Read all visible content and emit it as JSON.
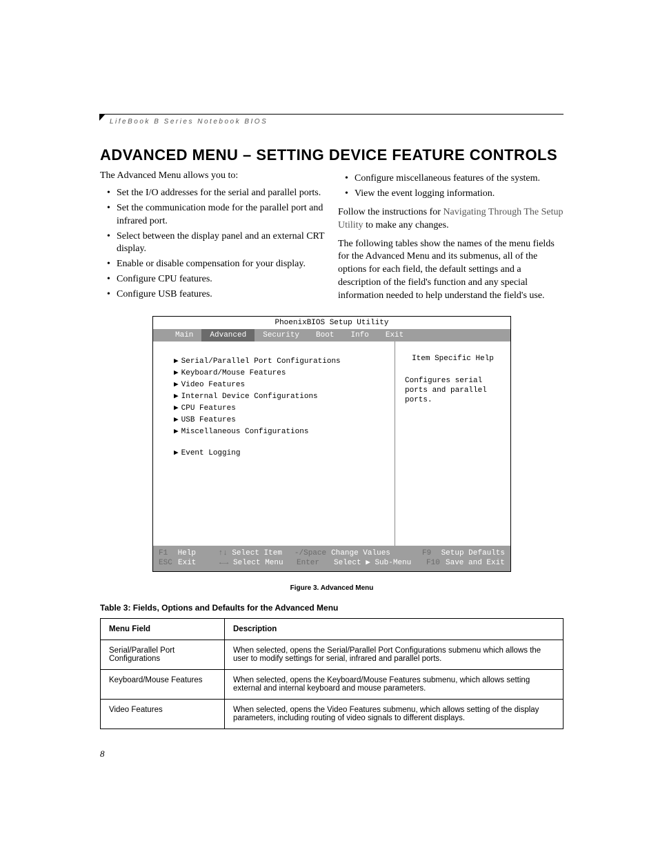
{
  "header": {
    "running": "LifeBook B Series Notebook BIOS"
  },
  "title": "ADVANCED MENU – SETTING DEVICE FEATURE CONTROLS",
  "leftCol": {
    "intro": "The Advanced Menu allows you to:",
    "bullets": [
      "Set the I/O addresses for the serial and parallel ports.",
      "Set the communication mode for the parallel port and infrared port.",
      "Select between the display panel and an external CRT display.",
      "Enable or disable compensation for your display.",
      "Configure CPU features.",
      "Configure USB features."
    ]
  },
  "rightCol": {
    "bullets": [
      "Configure miscellaneous features of the system.",
      "View the event logging information."
    ],
    "p1a": "Follow the instructions for ",
    "p1link": "Navigating Through The Setup Utility",
    "p1b": " to make any changes.",
    "p2": "The following tables show the names of the menu fields for the Advanced Menu and its submenus, all of the options for each field, the default settings and a description of the field's function and any special information needed to help understand the field's use."
  },
  "bios": {
    "title": "PhoenixBIOS Setup Utility",
    "tabs": [
      "Main",
      "Advanced",
      "Security",
      "Boot",
      "Info",
      "Exit"
    ],
    "selectedTab": 1,
    "items": [
      "Serial/Parallel Port Configurations",
      "Keyboard/Mouse Features",
      "Video Features",
      "Internal Device Configurations",
      "CPU Features",
      "USB Features",
      "Miscellaneous Configurations"
    ],
    "extraItem": "Event Logging",
    "help": {
      "title": "Item Specific Help",
      "text": "Configures serial ports and parallel ports."
    },
    "footer": {
      "r1": {
        "k1": "F1",
        "l1": "Help",
        "k2": "↑↓",
        "l2": "Select Item",
        "k3": "-/Space",
        "l3": "Change Values",
        "k4": "F9",
        "l4": "Setup Defaults"
      },
      "r2": {
        "k1": "ESC",
        "l1": "Exit",
        "k2": "←→",
        "l2": "Select Menu",
        "k3": "Enter",
        "l3a": "Select ",
        "l3b": " Sub-Menu",
        "k4": "F10",
        "l4": "Save and Exit"
      }
    }
  },
  "figCaption": "Figure 3.  Advanced Menu",
  "tableTitle": "Table 3: Fields, Options and Defaults for the Advanced Menu",
  "table": {
    "h1": "Menu Field",
    "h2": "Description",
    "rows": [
      {
        "f": "Serial/Parallel Port Configurations",
        "d": "When selected, opens the Serial/Parallel Port Configurations submenu which allows the user to modify settings for serial, infrared and parallel ports."
      },
      {
        "f": "Keyboard/Mouse Features",
        "d": "When selected, opens the Keyboard/Mouse Features submenu, which allows setting external and internal keyboard and mouse parameters."
      },
      {
        "f": "Video Features",
        "d": "When selected, opens the Video Features submenu, which allows setting of the display parameters, including routing of video signals to different displays."
      }
    ]
  },
  "pageNum": "8"
}
